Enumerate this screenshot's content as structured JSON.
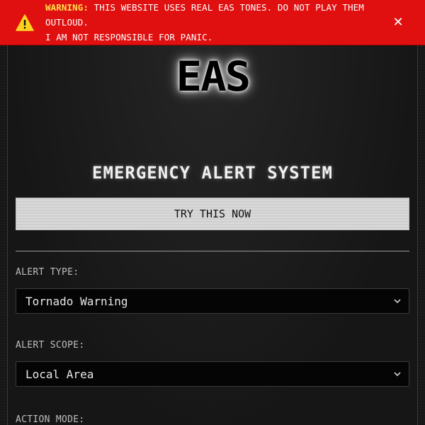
{
  "banner": {
    "label": "WARNING:",
    "message": "THIS WEBSITE USES REAL EAS TONES. DO NOT PLAY THEM OUTLOUD.",
    "message_line2": "I AM NOT RESPONSIBLE FOR PANIC.",
    "close": "✕",
    "icon": "warning-triangle-icon",
    "colors": {
      "background": "#e01010",
      "label": "#ffe14a",
      "text": "#ffffff"
    }
  },
  "logo": {
    "text": "EAS"
  },
  "title": "EMERGENCY ALERT SYSTEM",
  "try_button": "TRY THIS NOW",
  "fields": {
    "alert_type": {
      "label": "ALERT TYPE:",
      "value": "Tornado Warning"
    },
    "alert_scope": {
      "label": "ALERT SCOPE:",
      "value": "Local Area"
    },
    "action_mode": {
      "label": "ACTION MODE:"
    }
  }
}
